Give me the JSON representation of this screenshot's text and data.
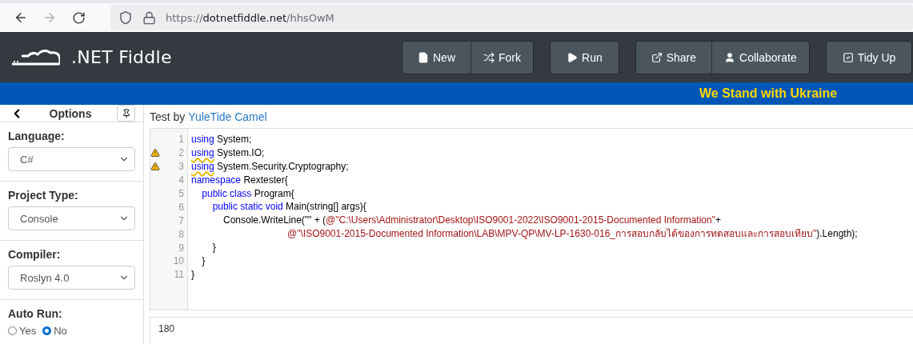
{
  "browser": {
    "back_disabled": false,
    "forward_disabled": true,
    "url": {
      "scheme": "https://",
      "host": "dotnetfiddle.net",
      "path": "/hhsOwM"
    }
  },
  "header": {
    "logo": ".NET Fiddle",
    "button_groups": [
      [
        {
          "label": "New"
        },
        {
          "label": "Fork"
        }
      ],
      [
        {
          "label": "Run"
        }
      ],
      [
        {
          "label": "Share"
        },
        {
          "label": "Collaborate"
        }
      ],
      [
        {
          "label": "Tidy Up"
        }
      ]
    ]
  },
  "banner": "We Stand with Ukraine",
  "sidebar": {
    "title": "Options",
    "sections": [
      {
        "kind": "select",
        "label": "Language:",
        "value": "C#"
      },
      {
        "kind": "select",
        "label": "Project Type:",
        "value": "Console"
      },
      {
        "kind": "select",
        "label": "Compiler:",
        "value": "Roslyn 4.0"
      },
      {
        "kind": "radio",
        "label": "Auto Run:",
        "options": [
          {
            "label": "Yes",
            "selected": false
          },
          {
            "label": "No",
            "selected": true
          }
        ]
      }
    ]
  },
  "fiddle": {
    "title_prefix": "Test by",
    "author": "YuleTide Camel"
  },
  "code_lines": [
    {
      "number": "1",
      "warning": false,
      "tokens": [
        {
          "kind": "keyword",
          "text": "using"
        },
        {
          "kind": "plain",
          "text": " System;"
        }
      ]
    },
    {
      "number": "2",
      "warning": true,
      "tokens": [
        {
          "kind": "keyword",
          "text": "using"
        },
        {
          "kind": "plain",
          "text": " System.IO;"
        }
      ]
    },
    {
      "number": "3",
      "warning": true,
      "tokens": [
        {
          "kind": "keyword",
          "text": "using"
        },
        {
          "kind": "plain",
          "text": " System.Security.Cryptography;"
        }
      ]
    },
    {
      "number": "4",
      "warning": false,
      "tokens": [
        {
          "kind": "keyword",
          "text": "namespace"
        },
        {
          "kind": "plain",
          "text": " Rextester{"
        }
      ]
    },
    {
      "number": "5",
      "warning": false,
      "tokens": [
        {
          "kind": "keyword",
          "text": "    public class"
        },
        {
          "kind": "plain",
          "text": " Program{"
        }
      ]
    },
    {
      "number": "6",
      "warning": false,
      "tokens": [
        {
          "kind": "keyword",
          "text": "        public static void"
        },
        {
          "kind": "plain",
          "text": " Main(string[] args){"
        }
      ]
    },
    {
      "number": "7",
      "warning": false,
      "tokens": [
        {
          "kind": "plain",
          "text": "            Console.WriteLine(\"\" + ("
        },
        {
          "kind": "string",
          "text": "@\"C:\\Users\\Administrator\\Desktop\\ISO9001-2022\\ISO9001-2015-Documented Information\""
        },
        {
          "kind": "plain",
          "text": "+"
        }
      ]
    },
    {
      "number": "8",
      "warning": false,
      "tokens": [
        {
          "kind": "string",
          "text": "                                    @\"\\ISO9001-2015-Documented Information\\LAB\\MPV-QP\\MV-LP-1630-016_การสอบกลับได้ของการทดสอบและการสอบเทียบ\""
        },
        {
          "kind": "plain",
          "text": ").Length);"
        }
      ]
    },
    {
      "number": "9",
      "warning": false,
      "tokens": [
        {
          "kind": "plain",
          "text": "        }"
        }
      ]
    },
    {
      "number": "10",
      "warning": false,
      "tokens": [
        {
          "kind": "plain",
          "text": "    }"
        }
      ]
    },
    {
      "number": "11",
      "warning": false,
      "tokens": [
        {
          "kind": "plain",
          "text": "}"
        }
      ]
    }
  ],
  "output": "180"
}
